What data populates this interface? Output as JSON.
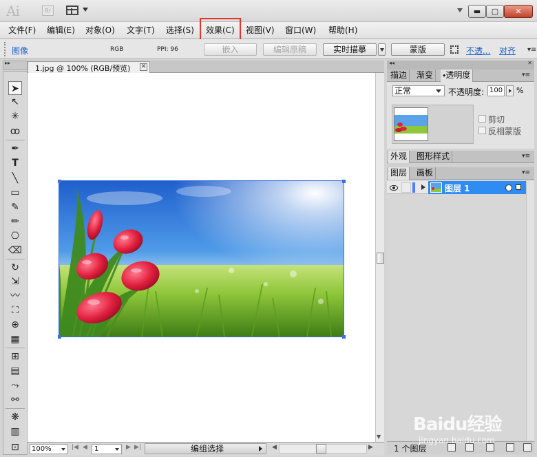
{
  "titlebar": {
    "app_logo": "Ai",
    "bridge_label": "Br",
    "buttons": {
      "minimize": "▬",
      "maximize": "▢",
      "close": "✕"
    }
  },
  "menu": {
    "items": [
      "文件(F)",
      "编辑(E)",
      "对象(O)",
      "文字(T)",
      "选择(S)",
      "效果(C)",
      "视图(V)",
      "窗口(W)",
      "帮助(H)"
    ],
    "highlighted_index": 5
  },
  "controlbar": {
    "object_type": "图像",
    "color_mode": "RGB",
    "ppi": "PPI: 96",
    "embed": "嵌入",
    "edit_original": "编辑原稿",
    "live_trace": "实时描摹",
    "mask": "蒙版",
    "opacity_link": "不透...",
    "align_link": "对齐"
  },
  "document": {
    "tab_title": "1.jpg @ 100% (RGB/预览)",
    "close_glyph": "✕"
  },
  "statusbar": {
    "zoom": "100%",
    "page": "1",
    "status": "编组选择"
  },
  "panels": {
    "top_tabs": [
      "描边",
      "渐变",
      "透明度"
    ],
    "top_active": 2,
    "blend_mode": "正常",
    "opacity_label": "不透明度:",
    "opacity_value": "100",
    "opacity_unit": "%",
    "clip_label": "剪切",
    "invert_mask_label": "反相蒙版",
    "appearance_tabs": [
      "外观",
      "图形样式"
    ],
    "layers_tabs": [
      "图层",
      "画板"
    ],
    "layer_name": "图层 1",
    "layer_count": "1 个图层"
  },
  "tools": [
    "selection-tool",
    "direct-selection-tool",
    "magic-wand-tool",
    "lasso-tool",
    "pen-tool",
    "type-tool",
    "line-segment-tool",
    "rectangle-tool",
    "paintbrush-tool",
    "pencil-tool",
    "blob-brush-tool",
    "eraser-tool",
    "rotate-tool",
    "scale-tool",
    "warp-tool",
    "free-transform-tool",
    "shape-builder-tool",
    "perspective-grid-tool",
    "mesh-tool",
    "gradient-tool",
    "eyedropper-tool",
    "blend-tool",
    "symbol-sprayer-tool",
    "column-graph-tool",
    "artboard-tool"
  ],
  "watermark": {
    "logo": "Baidu经验",
    "url": "jingyan.baidu.com"
  },
  "colors": {
    "highlight_box": "#e8312b",
    "selection": "#3d6fe0",
    "layer_selected": "#2f8cf2",
    "link": "#1a5fd0"
  }
}
